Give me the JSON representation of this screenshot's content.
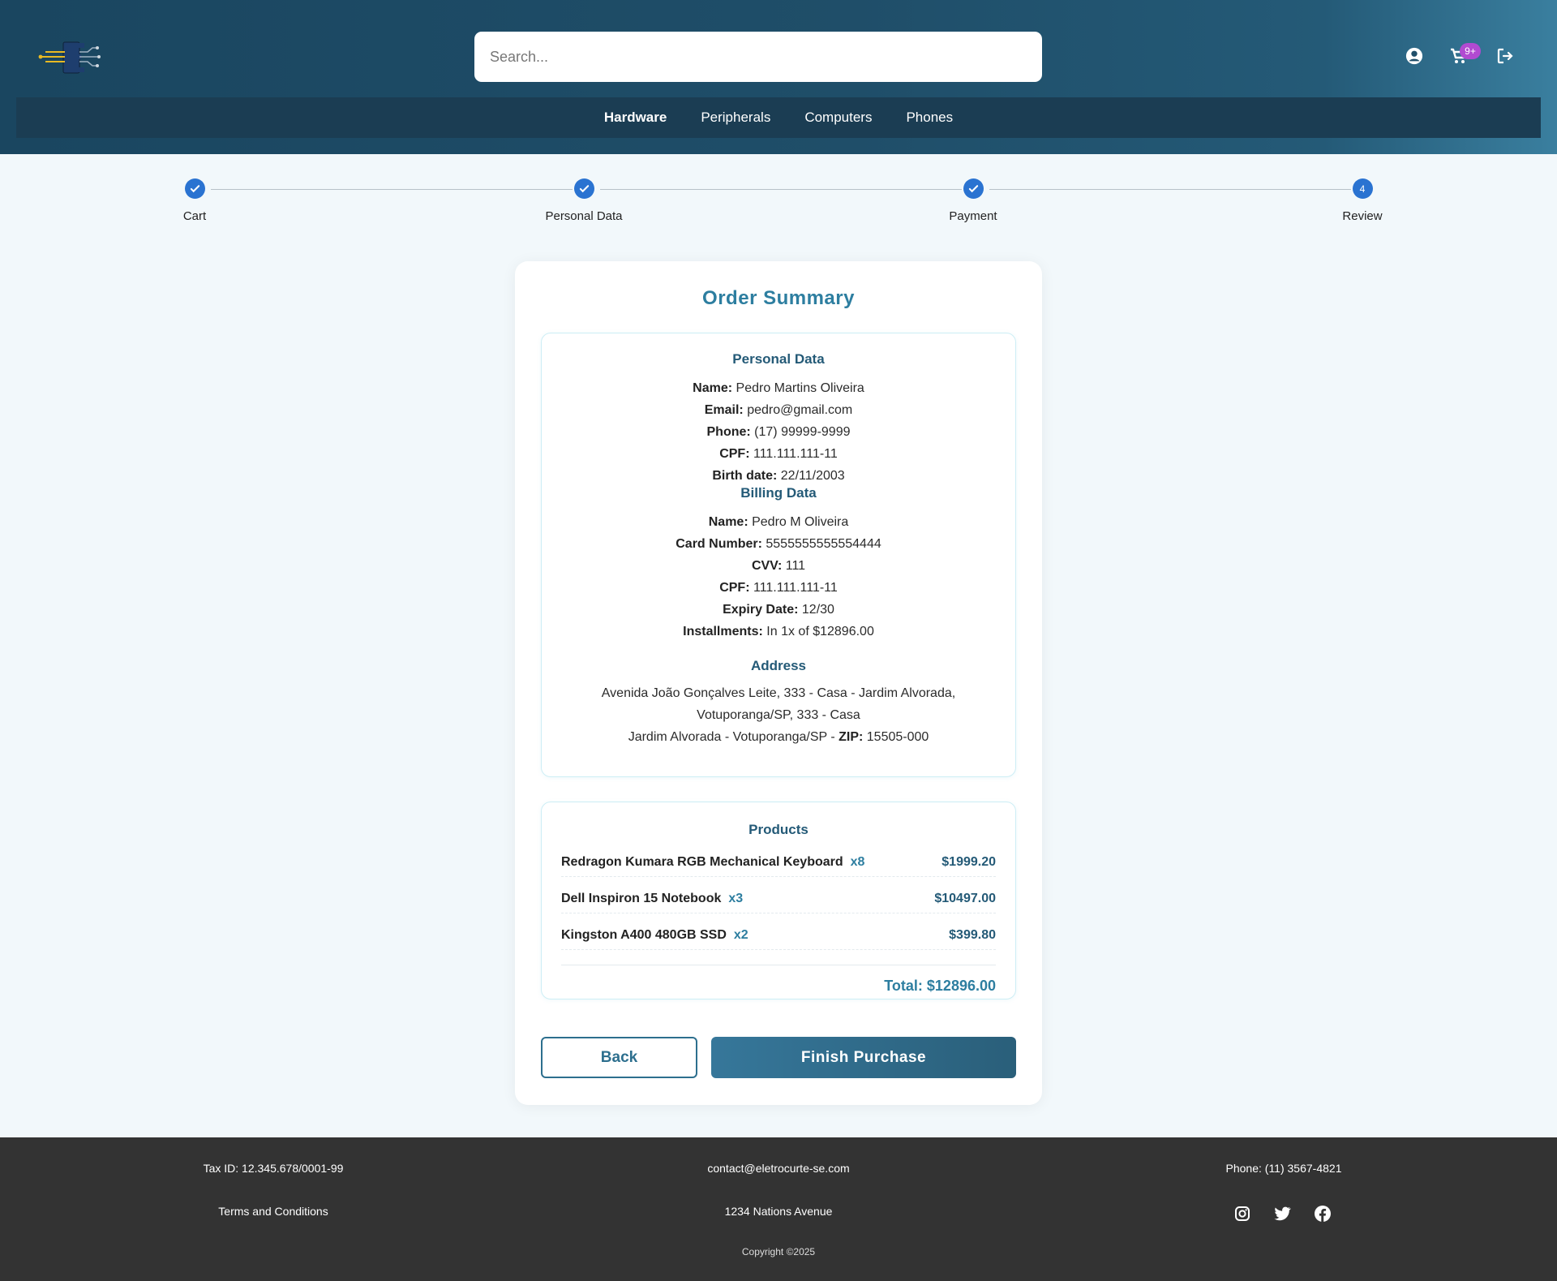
{
  "header": {
    "search_placeholder": "Search...",
    "cart_badge": "9+",
    "nav": [
      {
        "label": "Hardware",
        "active": true
      },
      {
        "label": "Peripherals"
      },
      {
        "label": "Computers"
      },
      {
        "label": "Phones"
      }
    ]
  },
  "stepper": {
    "steps": [
      {
        "label": "Cart",
        "status": "done",
        "icon": "check-icon"
      },
      {
        "label": "Personal Data",
        "status": "done",
        "icon": "check-icon"
      },
      {
        "label": "Payment",
        "status": "done",
        "icon": "check-icon"
      },
      {
        "label": "Review",
        "status": "current",
        "number": "4"
      }
    ]
  },
  "summary": {
    "title": "Order Summary",
    "personal": {
      "title": "Personal Data",
      "name_label": "Name:",
      "name": "Pedro Martins Oliveira",
      "email_label": "Email:",
      "email": "pedro@gmail.com",
      "phone_label": "Phone:",
      "phone": "(17) 99999-9999",
      "cpf_label": "CPF:",
      "cpf": "111.111.111-11",
      "birth_label": "Birth date:",
      "birth": "22/11/2003"
    },
    "billing": {
      "title": "Billing Data",
      "name_label": "Name:",
      "name": "Pedro M Oliveira",
      "card_label": "Card Number:",
      "card": "5555555555554444",
      "cvv_label": "CVV:",
      "cvv": "111",
      "cpf_label": "CPF:",
      "cpf": "111.111.111-11",
      "expiry_label": "Expiry Date:",
      "expiry": "12/30",
      "installments_label": "Installments:",
      "installments": "In 1x of $12896.00"
    },
    "address": {
      "title": "Address",
      "line1": "Avenida João Gonçalves Leite, 333 - Casa - Jardim Alvorada,",
      "line2": "Votuporanga/SP, 333 - Casa",
      "line3": "Jardim Alvorada - Votuporanga/SP - ",
      "zip_label": "ZIP:",
      "zip": "15505-000"
    },
    "products": {
      "title": "Products",
      "items": [
        {
          "name": "Redragon Kumara RGB Mechanical Keyboard",
          "qty": "x8",
          "price": "$1999.20"
        },
        {
          "name": "Dell Inspiron 15 Notebook",
          "qty": "x3",
          "price": "$10497.00"
        },
        {
          "name": "Kingston A400 480GB SSD",
          "qty": "x2",
          "price": "$399.80"
        }
      ],
      "total": "Total: $12896.00"
    },
    "back_label": "Back",
    "finish_label": "Finish Purchase"
  },
  "footer": {
    "tax_id": "Tax ID: 12.345.678/0001-99",
    "email": "contact@eletrocurte-se.com",
    "phone": "Phone: (11) 3567-4821",
    "terms": "Terms and Conditions",
    "address": "1234 Nations Avenue",
    "copyright": "Copyright ©2025"
  },
  "colors": {
    "header_dark": "#1b3d53",
    "accent": "#2d7ea0",
    "step_blue": "#2a73d1",
    "badge": "#b14ad1",
    "footer": "#333333"
  }
}
